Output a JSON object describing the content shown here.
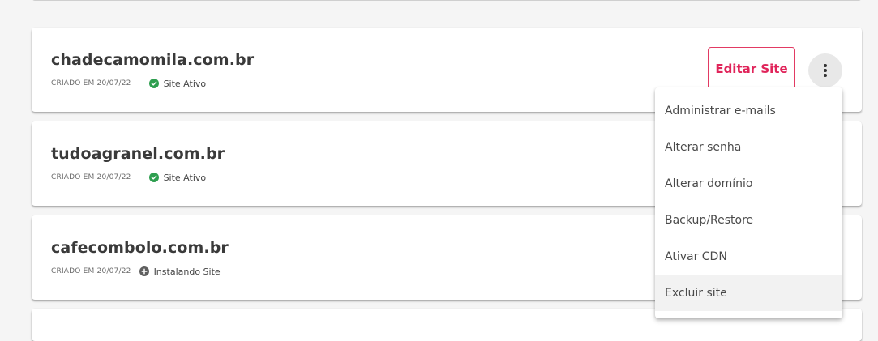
{
  "sites": [
    {
      "name": "chadecamomila.com.br",
      "created": "CRIADO EM 20/07/22",
      "status": "Site Ativo",
      "status_color": "#2e9e4f",
      "status_icon": "check-circle-icon"
    },
    {
      "name": "tudoagranel.com.br",
      "created": "CRIADO EM 20/07/22",
      "status": "Site Ativo",
      "status_color": "#2e9e4f",
      "status_icon": "check-circle-icon"
    },
    {
      "name": "cafecombolo.com.br",
      "created": "CRIADO EM 20/07/22",
      "status": "Instalando Site",
      "status_color": "#5f5f5f",
      "status_icon": "plus-circle-icon"
    }
  ],
  "actions": {
    "edit_label": "Editar Site",
    "more_icon": "more-vertical-icon"
  },
  "menu": {
    "items": [
      {
        "label": "Administrar e-mails"
      },
      {
        "label": "Alterar senha"
      },
      {
        "label": "Alterar domínio"
      },
      {
        "label": "Backup/Restore"
      },
      {
        "label": "Ativar CDN"
      },
      {
        "label": "Excluir site"
      }
    ]
  },
  "colors": {
    "accent": "#e0245a",
    "active": "#2e9e4f",
    "installing": "#5f5f5f"
  }
}
